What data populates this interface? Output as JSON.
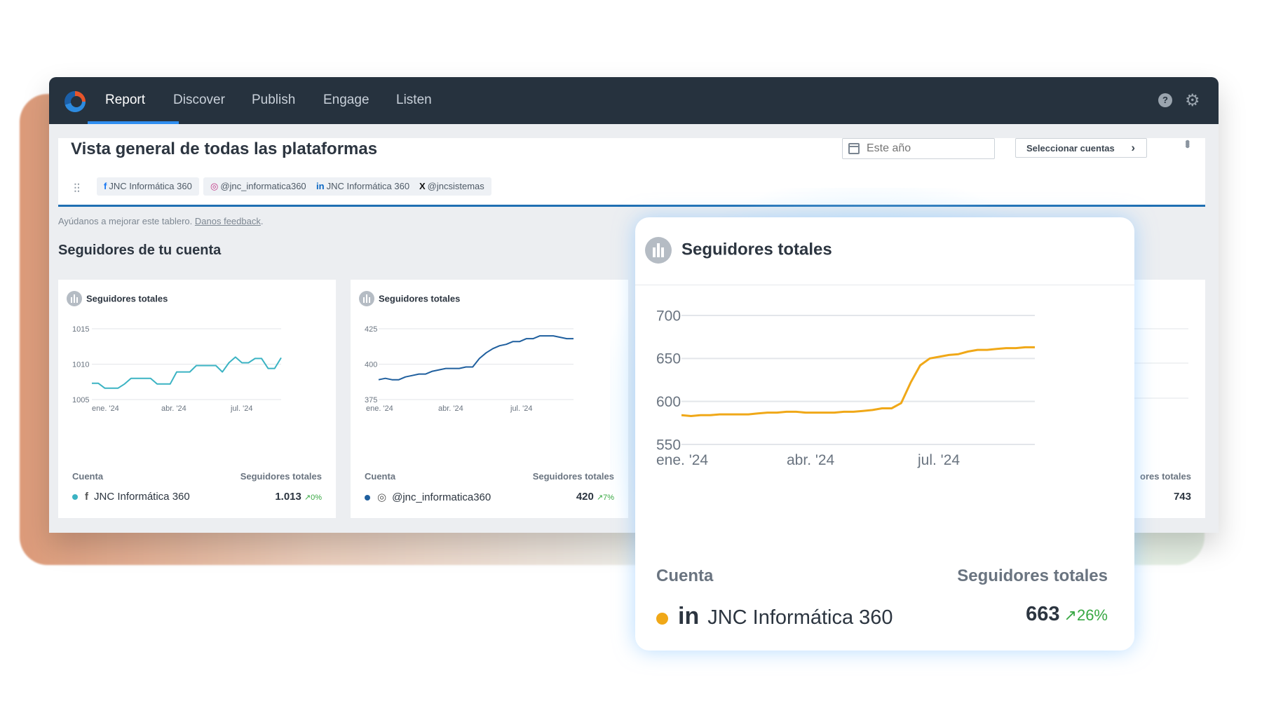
{
  "nav": {
    "items": [
      "Report",
      "Discover",
      "Publish",
      "Engage",
      "Listen"
    ],
    "active": "Report",
    "help_icon": "help-circle-icon",
    "settings_icon": "gear-icon"
  },
  "header": {
    "title": "Vista general de todas las plataformas",
    "date_placeholder": "Este año",
    "select_accounts": "Seleccionar cuentas",
    "chips": [
      {
        "icon": "f",
        "label": "JNC Informática 360"
      },
      {
        "icon": "◎",
        "label": "@jnc_informatica360"
      },
      {
        "icon": "in",
        "label": "JNC Informática 360"
      },
      {
        "icon": "X",
        "label": "@jncsistemas"
      }
    ]
  },
  "feedback": {
    "text": "Ayúdanos a mejorar este tablero.",
    "link": "Danos feedback",
    "suffix": "."
  },
  "section_title": "Seguidores de tu cuenta",
  "cards": [
    {
      "title": "Seguidores totales",
      "col_account": "Cuenta",
      "col_value": "Seguidores totales",
      "account": "JNC Informática 360",
      "value": "1.013",
      "change": "0%",
      "color": "#3bb3c3"
    },
    {
      "title": "Seguidores totales",
      "col_account": "Cuenta",
      "col_value": "Seguidores totales",
      "account": "@jnc_informatica360",
      "value": "420",
      "change": "7%",
      "color": "#1f5f9e"
    }
  ],
  "right_card": {
    "col_value": "ores totales",
    "value": "743",
    "tick": "4"
  },
  "zoom": {
    "title": "Seguidores totales",
    "col_account": "Cuenta",
    "col_value": "Seguidores totales",
    "account": "JNC Informática 360",
    "value": "663",
    "change": "26%",
    "color": "#f0a818"
  },
  "chart_data": [
    {
      "type": "line",
      "title": "Seguidores totales",
      "x_ticks": [
        "ene. '24",
        "abr. '24",
        "jul. '24"
      ],
      "ylim": [
        1005,
        1015
      ],
      "y_ticks": [
        1005,
        1010,
        1015
      ],
      "series": [
        {
          "name": "JNC Informática 360",
          "values": [
            1007.3,
            1007.3,
            1006.6,
            1006.6,
            1006.6,
            1007.2,
            1008,
            1008,
            1008,
            1008,
            1007.2,
            1007.2,
            1007.2,
            1008.9,
            1008.9,
            1008.9,
            1009.8,
            1009.8,
            1009.8,
            1009.8,
            1008.9,
            1010.2,
            1011,
            1010.2,
            1010.2,
            1010.8,
            1010.8,
            1009.4,
            1009.4,
            1010.9
          ]
        }
      ]
    },
    {
      "type": "line",
      "title": "Seguidores totales",
      "x_ticks": [
        "ene. '24",
        "abr. '24",
        "jul. '24"
      ],
      "ylim": [
        375,
        425
      ],
      "y_ticks": [
        375,
        400,
        425
      ],
      "series": [
        {
          "name": "@jnc_informatica360",
          "values": [
            389,
            390,
            389,
            389,
            391,
            392,
            393,
            393,
            395,
            396,
            397,
            397,
            397,
            398,
            398,
            404,
            408,
            411,
            413,
            414,
            416,
            416,
            418,
            418,
            420,
            420,
            420,
            419,
            418,
            418
          ]
        }
      ]
    },
    {
      "type": "line",
      "title": "Seguidores totales",
      "x_ticks": [
        "ene. '24",
        "abr. '24",
        "jul. '24"
      ],
      "ylim": [
        550,
        700
      ],
      "y_ticks": [
        550,
        600,
        650,
        700
      ],
      "series": [
        {
          "name": "JNC Informática 360",
          "values": [
            584,
            583,
            584,
            584,
            585,
            585,
            585,
            585,
            586,
            587,
            587,
            588,
            588,
            587,
            587,
            587,
            587,
            588,
            588,
            589,
            590,
            592,
            592,
            598,
            622,
            642,
            650,
            652,
            654,
            655,
            658,
            660,
            660,
            661,
            662,
            662,
            663,
            663
          ]
        }
      ]
    }
  ]
}
